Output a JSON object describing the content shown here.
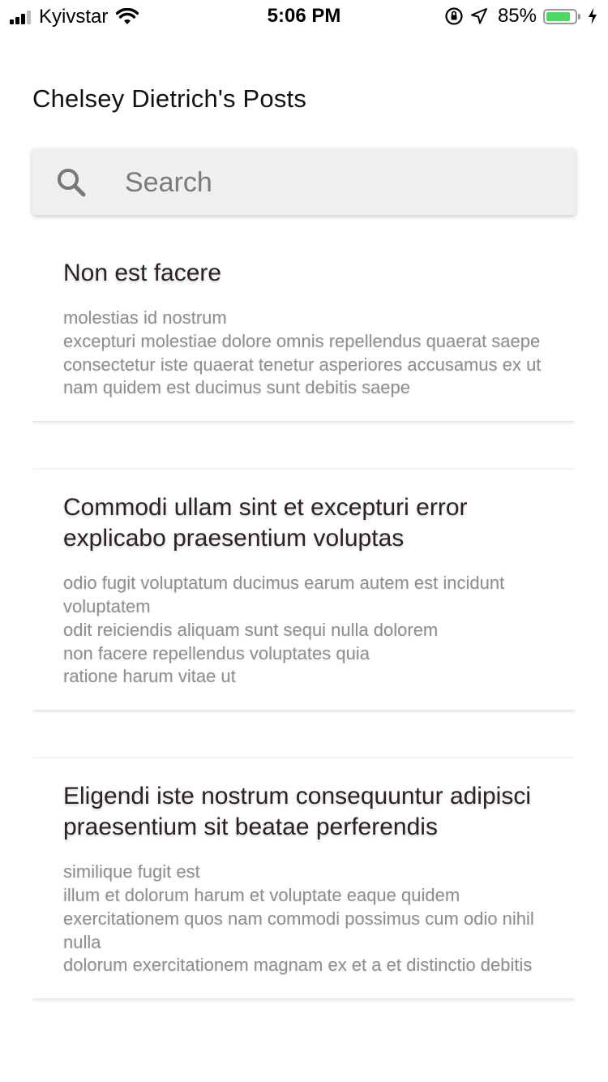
{
  "status_bar": {
    "carrier": "Kyivstar",
    "time": "5:06 PM",
    "battery_percent_text": "85%",
    "battery_level": 0.85,
    "battery_color": "#4cd964"
  },
  "header": {
    "title": "Chelsey Dietrich's Posts"
  },
  "search": {
    "placeholder": "Search",
    "value": "",
    "icon": "search-icon"
  },
  "posts": [
    {
      "title": "Non est facere",
      "body": "molestias id nostrum\nexcepturi molestiae dolore omnis repellendus quaerat saepe\nconsectetur iste quaerat tenetur asperiores accusamus ex ut\nnam quidem est ducimus sunt debitis saepe"
    },
    {
      "title": "Commodi ullam sint et excepturi error explicabo praesentium voluptas",
      "body": "odio fugit voluptatum ducimus earum autem est incidunt voluptatem\nodit reiciendis aliquam sunt sequi nulla dolorem\nnon facere repellendus voluptates quia\nratione harum vitae ut"
    },
    {
      "title": "Eligendi iste nostrum consequuntur adipisci praesentium sit beatae perferendis",
      "body": "similique fugit est\nillum et dolorum harum et voluptate eaque quidem\nexercitationem quos nam commodi possimus cum odio nihil nulla\ndolorum exercitationem magnam ex et a et distinctio debitis"
    }
  ]
}
